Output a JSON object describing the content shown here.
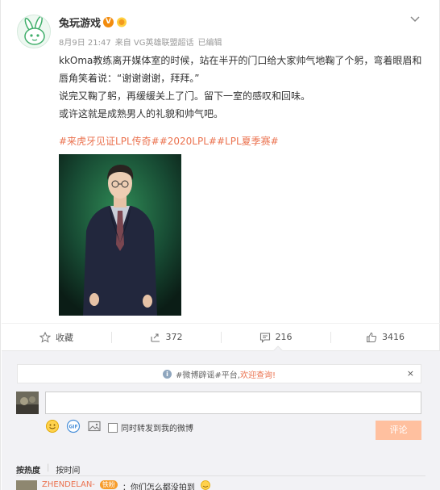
{
  "post": {
    "author": "兔玩游戏",
    "verified_mark": "V",
    "date": "8月9日 21:47",
    "source": "来自 VG英雄联盟超话",
    "edited": "已编辑",
    "paragraphs": [
      "kkOma教练离开媒体室的时候，站在半开的门口给大家帅气地鞠了个躬，弯着眼眉和唇角笑着说：“谢谢谢谢，拜拜。”",
      "说完又鞠了躬，再缓缓关上了门。留下一室的感叹和回味。",
      "或许这就是成熟男人的礼貌和帅气吧。"
    ],
    "hashtags": "#来虎牙见证LPL传奇##2020LPL##LPL夏季赛#"
  },
  "actions": {
    "favorite_label": "收藏",
    "repost_count": "372",
    "comment_count": "216",
    "like_count": "3416"
  },
  "comment_box": {
    "notice_prefix": "#微博辟谣#平台,",
    "notice_link": "欢迎查询!",
    "notice_close": "×",
    "input_value": "",
    "repost_label": "同时转发到我的微博",
    "submit_label": "评论"
  },
  "sort": {
    "by_hot": "按热度",
    "by_time": "按时间"
  },
  "first_comment": {
    "name": "ZHENDELAN-",
    "badge": "铁粉",
    "text": "：你们怎么都没拍到"
  },
  "colors": {
    "accent": "#eb7350",
    "submit_disabled": "#ffc09f",
    "comment_bg": "#f2f2f5"
  },
  "icons": {
    "more": "chevron-down-icon",
    "favorite": "star-icon",
    "repost": "repost-icon",
    "comment": "comment-icon",
    "like": "thumb-up-icon",
    "emoji": "emoji-icon",
    "gif": "gif-icon",
    "image": "image-icon"
  }
}
